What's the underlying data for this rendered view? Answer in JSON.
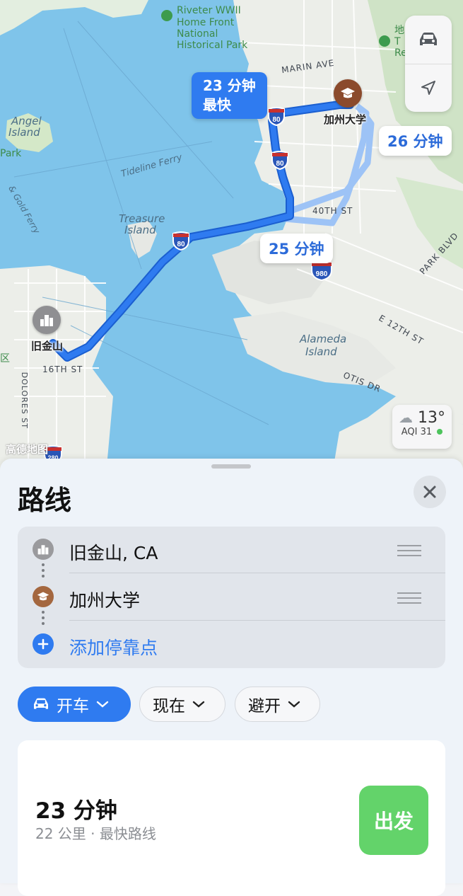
{
  "map": {
    "labels": {
      "rosie_riveter": "Riveter WWII",
      "rosie_home_front": "Home Front",
      "rosie_national": "National",
      "rosie_historical": "Historical Park",
      "angel_island_1": "Angel",
      "angel_island_2": "Island",
      "tideline_ferry": "Tideline Ferry",
      "gold_ferry": "& Gold Ferry",
      "park_left": "Park",
      "treasure_island_1": "Treasure",
      "treasure_island_2": "Island",
      "marin_ave": "MARIN AVE",
      "fortieth_st": "40TH ST",
      "park_blvd": "PARK BLVD",
      "e12th_st": "E 12TH ST",
      "alameda_1": "Alameda",
      "alameda_2": "Island",
      "otis_dr": "OTIS DR",
      "dolores_st": "DOLORES ST",
      "sixteenth_st": "16TH ST",
      "district_fragment": "区",
      "top_right_fragment_1": "地",
      "top_right_fragment_2": "T",
      "top_right_fragment_3": "Re"
    },
    "eta_primary_time": "23 分钟",
    "eta_primary_note": "最快",
    "eta_alt_1": "26 分钟",
    "eta_alt_2": "25 分钟",
    "origin_name": "旧金山",
    "destination_name": "加州大学",
    "shields": [
      "80",
      "80",
      "80",
      "980",
      "280"
    ],
    "weather_temp": "13°",
    "weather_aqi": "AQI 31",
    "attribution": "高德地图",
    "colors": {
      "route_primary": "#2f7bf0",
      "route_alt": "#9dc3f6",
      "water": "#7fc4ea",
      "land": "#eef0ec",
      "go_button": "#63d36a"
    }
  },
  "sheet": {
    "title": "路线",
    "stops": [
      {
        "label": "旧金山, CA",
        "icon": "city-icon"
      },
      {
        "label": "加州大学",
        "icon": "graduation-cap-icon"
      },
      {
        "label": "添加停靠点",
        "icon": "plus-icon"
      }
    ],
    "chips": {
      "mode": "开车",
      "time": "现在",
      "avoid": "避开"
    },
    "route": {
      "time": "23 分钟",
      "detail": "22 公里 · 最快路线",
      "go": "出发"
    }
  }
}
